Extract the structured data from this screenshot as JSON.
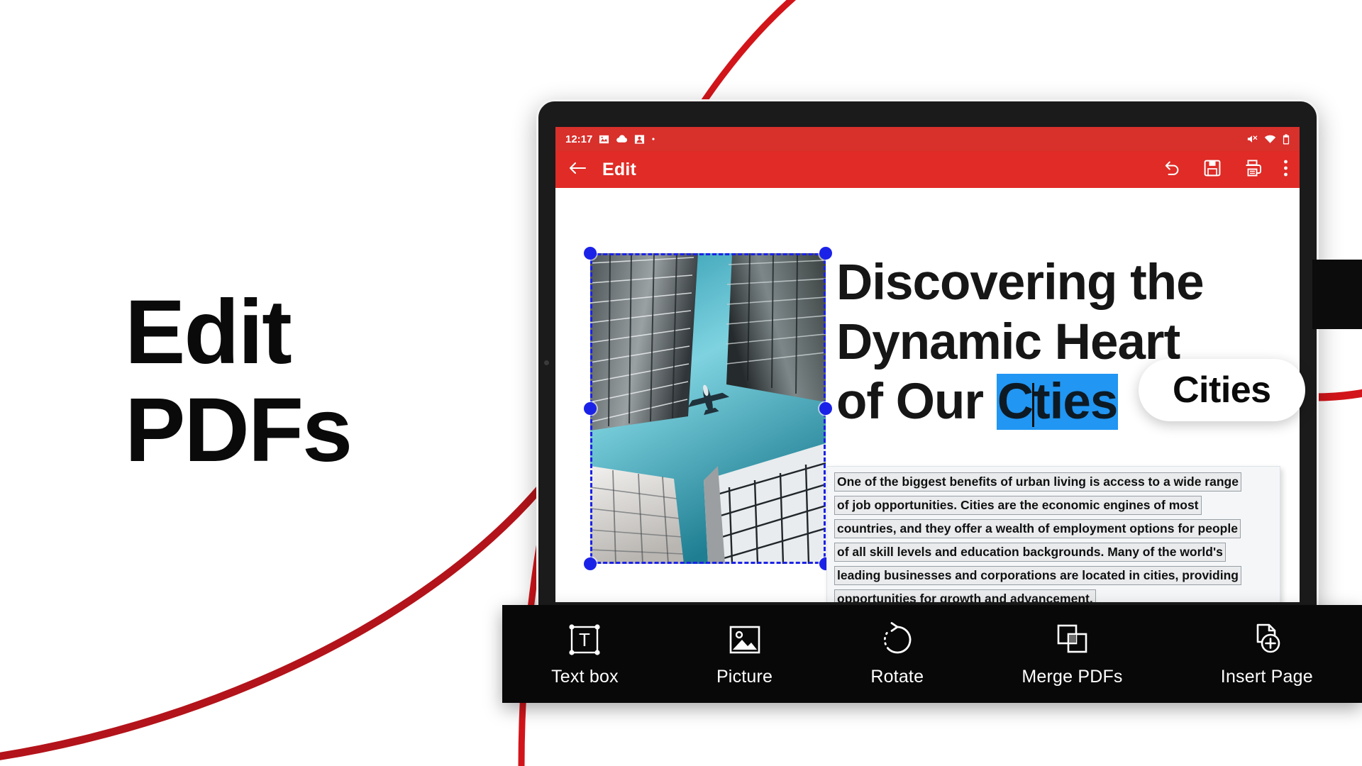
{
  "promo": {
    "line1": "Edit",
    "line2": "PDFs"
  },
  "colors": {
    "accent_red": "#d8302b",
    "appbar_red": "#e02b26",
    "selection_blue": "#1b22e8",
    "text_highlight_blue": "#2196F3",
    "toolbar_black": "#080808",
    "decor_red": "#d2151a"
  },
  "device": {
    "statusbar": {
      "time": "12:17",
      "left_icons": [
        "image-icon",
        "cloud-icon",
        "contact-icon",
        "dot-icon"
      ],
      "right_icons": [
        "volume-off-icon",
        "wifi-icon",
        "battery-icon"
      ]
    },
    "appbar": {
      "back_icon": "back-arrow-icon",
      "title": "Edit",
      "actions": [
        {
          "name": "undo-icon",
          "label": "Undo"
        },
        {
          "name": "save-icon",
          "label": "Save"
        },
        {
          "name": "print-icon",
          "label": "Print"
        },
        {
          "name": "more-options-icon",
          "label": "More options"
        }
      ]
    }
  },
  "document": {
    "image": {
      "alt": "Looking up at skyscrapers with an airplane in teal sky",
      "selected": true,
      "handles": [
        "top-left",
        "top-right",
        "middle-left",
        "middle-right",
        "bottom-left",
        "bottom-right"
      ]
    },
    "headline": {
      "line1": "Discovering the",
      "line2": "Dynamic Heart",
      "line3_prefix": "of Our ",
      "selected_before_caret": "C",
      "selected_after_caret": "ties"
    },
    "paragraph_lines": [
      "One of the biggest benefits of urban living is access to a wide range",
      "of job opportunities. Cities are the economic engines of most",
      "countries, and they offer a wealth of employment options for people",
      "of all skill levels and education backgrounds. Many of the world's",
      "leading businesses and corporations are located in cities, providing",
      "opportunities for growth and advancement."
    ]
  },
  "callout": {
    "text": "Cities"
  },
  "bottom_toolbar": {
    "items": [
      {
        "label": "Text box",
        "icon": "text-box-icon"
      },
      {
        "label": "Picture",
        "icon": "picture-icon"
      },
      {
        "label": "Rotate",
        "icon": "rotate-icon"
      },
      {
        "label": "Merge PDFs",
        "icon": "merge-pdfs-icon"
      },
      {
        "label": "Insert Page",
        "icon": "insert-page-icon"
      }
    ]
  }
}
